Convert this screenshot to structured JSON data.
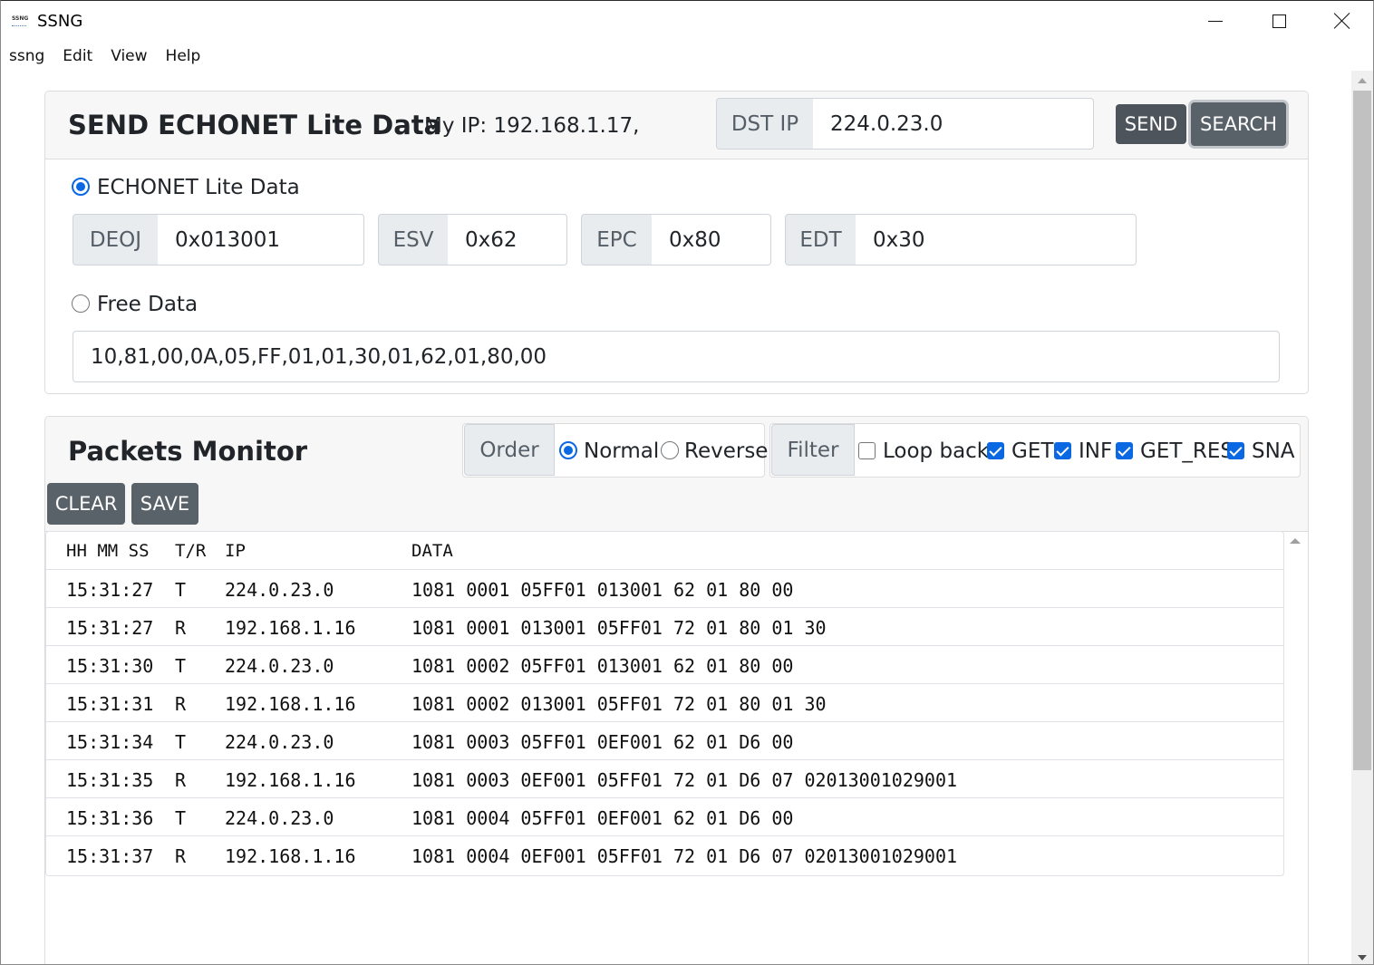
{
  "window": {
    "icon_text": "SSNG",
    "title": "SSNG"
  },
  "menu": [
    "ssng",
    "Edit",
    "View",
    "Help"
  ],
  "send_panel": {
    "title": "SEND ECHONET Lite Data",
    "my_ip": "My IP: 192.168.1.17,",
    "dst_ip_label": "DST IP",
    "dst_ip_value": "224.0.23.0",
    "send_label": "SEND",
    "search_label": "SEARCH",
    "echonet_option_label": "ECHONET Lite Data",
    "echonet_option_checked": true,
    "fields": {
      "deoj_label": "DEOJ",
      "deoj_value": "0x013001",
      "esv_label": "ESV",
      "esv_value": "0x62",
      "epc_label": "EPC",
      "epc_value": "0x80",
      "edt_label": "EDT",
      "edt_value": "0x30"
    },
    "free_option_label": "Free Data",
    "free_option_checked": false,
    "free_data_value": "10,81,00,0A,05,FF,01,01,30,01,62,01,80,00"
  },
  "monitor": {
    "title": "Packets Monitor",
    "order_label": "Order",
    "order_normal": "Normal",
    "order_reverse": "Reverse",
    "order_selected": "Normal",
    "filter_label": "Filter",
    "filters": {
      "loopback": {
        "label": "Loop back",
        "checked": false
      },
      "get": {
        "label": "GET",
        "checked": true
      },
      "inf": {
        "label": "INF",
        "checked": true
      },
      "get_res": {
        "label": "GET_RES",
        "checked": true
      },
      "sna": {
        "label": "SNA",
        "checked": true
      }
    },
    "clear_label": "CLEAR",
    "save_label": "SAVE",
    "columns": {
      "time": "HH MM SS",
      "tr": "T/R",
      "ip": "IP",
      "data": "DATA"
    },
    "rows": [
      {
        "time": "15:31:27",
        "tr": "T",
        "ip": "224.0.23.0",
        "data": "1081 0001 05FF01 013001 62 01 80 00"
      },
      {
        "time": "15:31:27",
        "tr": "R",
        "ip": "192.168.1.16",
        "data": "1081 0001 013001 05FF01 72 01 80 01 30"
      },
      {
        "time": "15:31:30",
        "tr": "T",
        "ip": "224.0.23.0",
        "data": "1081 0002 05FF01 013001 62 01 80 00"
      },
      {
        "time": "15:31:31",
        "tr": "R",
        "ip": "192.168.1.16",
        "data": "1081 0002 013001 05FF01 72 01 80 01 30"
      },
      {
        "time": "15:31:34",
        "tr": "T",
        "ip": "224.0.23.0",
        "data": "1081 0003 05FF01 0EF001 62 01 D6 00"
      },
      {
        "time": "15:31:35",
        "tr": "R",
        "ip": "192.168.1.16",
        "data": "1081 0003 0EF001 05FF01 72 01 D6 07 02013001029001"
      },
      {
        "time": "15:31:36",
        "tr": "T",
        "ip": "224.0.23.0",
        "data": "1081 0004 05FF01 0EF001 62 01 D6 00"
      },
      {
        "time": "15:31:37",
        "tr": "R",
        "ip": "192.168.1.16",
        "data": "1081 0004 0EF001 05FF01 72 01 D6 07 02013001029001"
      }
    ]
  },
  "colors": {
    "accent": "#0a68e3",
    "button": "#5a6269",
    "header_bg": "#f7f7f7"
  }
}
